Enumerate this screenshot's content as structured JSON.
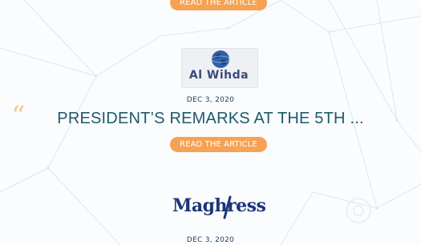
{
  "articles": [
    {
      "button_label": "READ THE ARTICLE"
    },
    {
      "source_logo_text": "Al Wihda",
      "date": "DEC 3, 2020",
      "headline": "PRESIDENT’S REMARKS AT THE 5TH ...",
      "button_label": "READ THE ARTICLE"
    },
    {
      "source_logo_text": "Maghress",
      "date": "DEC 3, 2020"
    }
  ],
  "decoration": {
    "quote_glyph": "“",
    "colors": {
      "accent_orange": "#f5a254",
      "headline_teal": "#1c5a6a",
      "date_navy": "#1a3a5e",
      "maghress_blue": "#1d3579",
      "alwihda_navy": "#3b4a7a"
    },
    "icons": [
      "globe-icon",
      "quote-icon",
      "network-lines-background"
    ]
  }
}
